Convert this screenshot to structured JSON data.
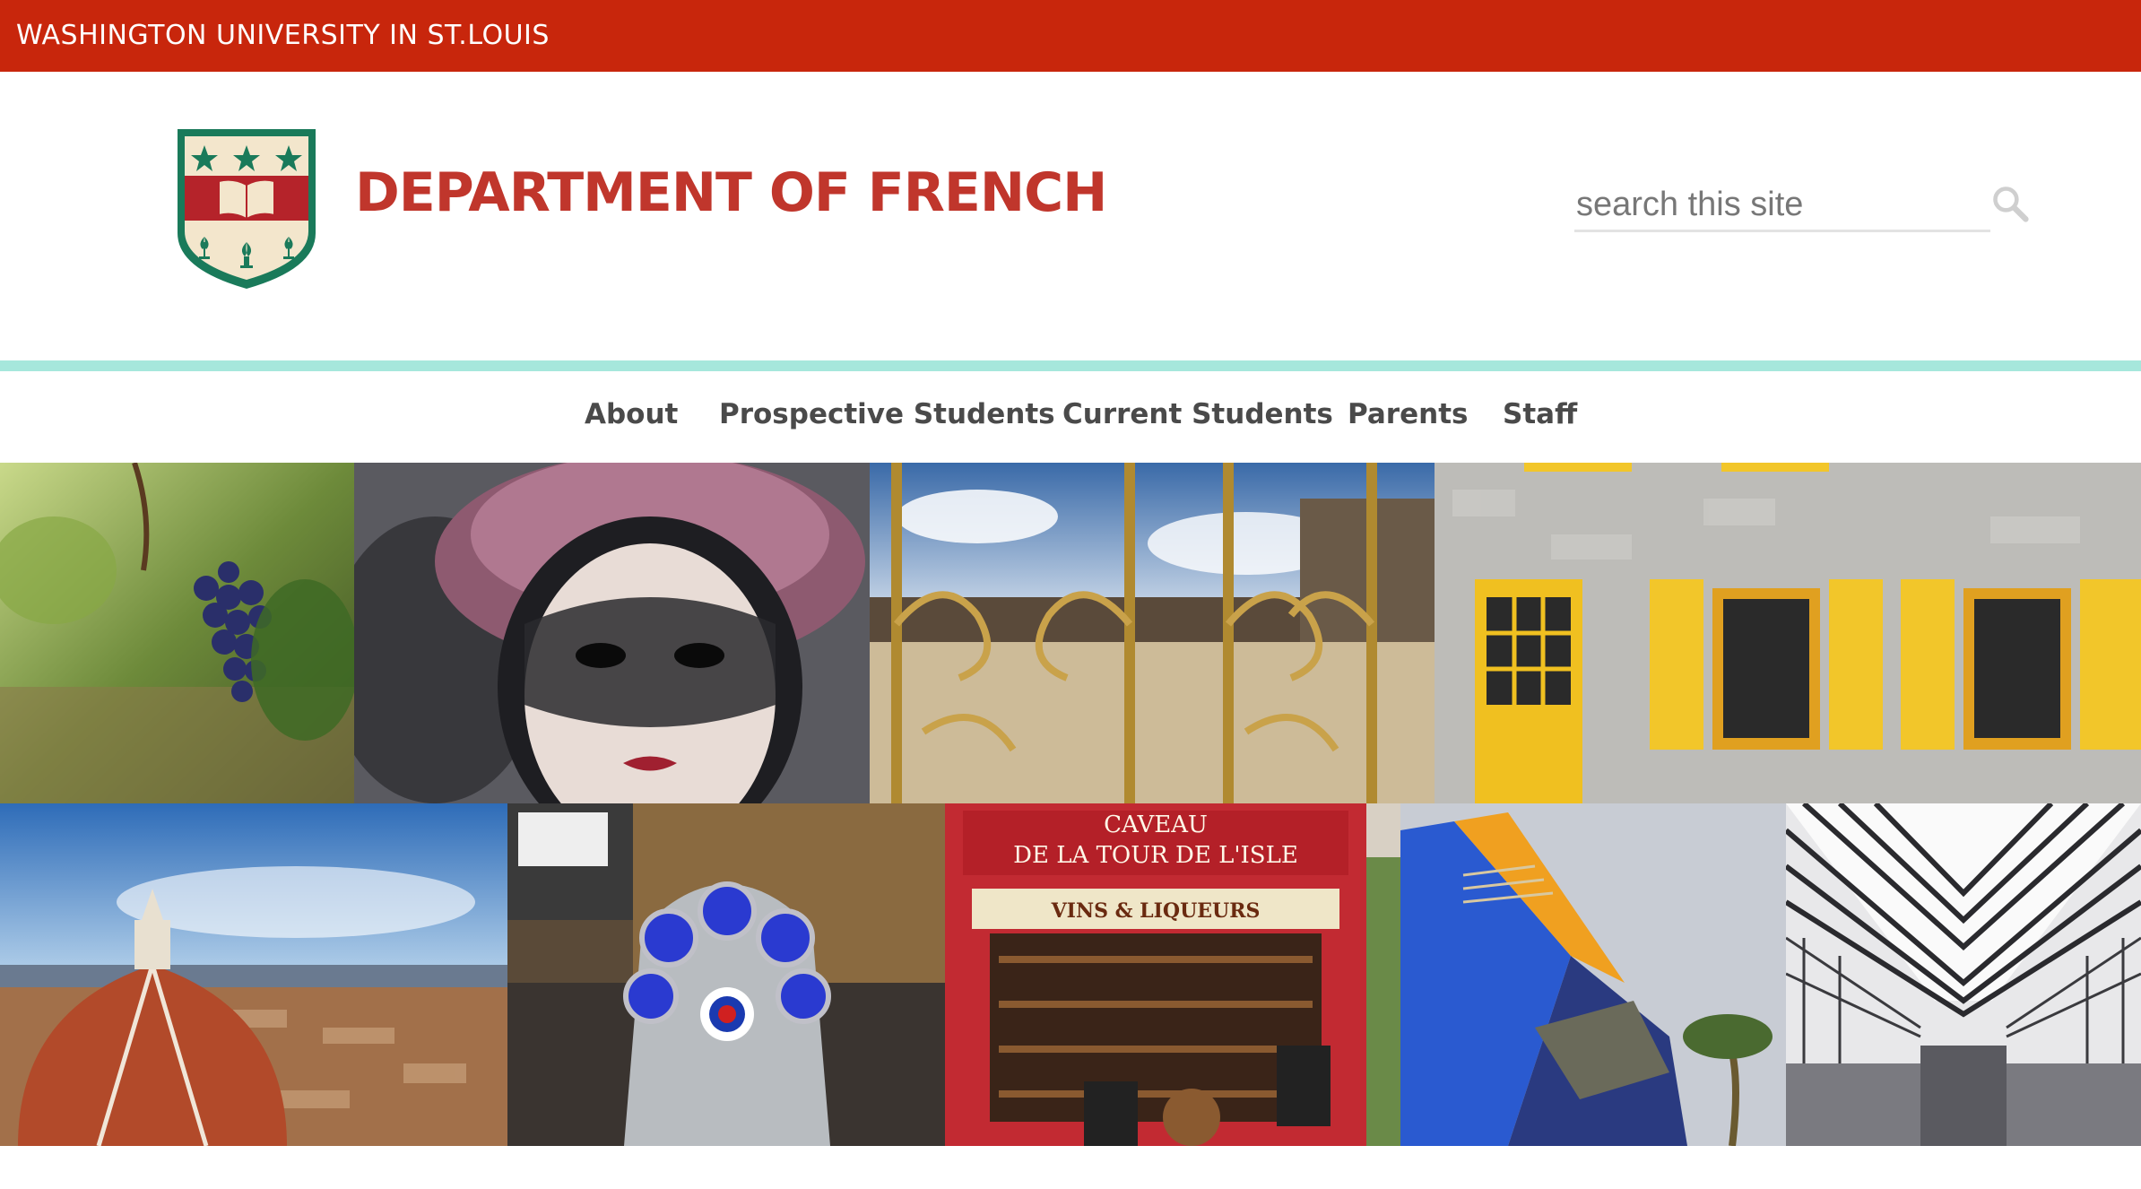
{
  "topbar": {
    "university": "WASHINGTON UNIVERSITY IN ST.LOUIS"
  },
  "header": {
    "department_title": "DEPARTMENT OF FRENCH",
    "logo_icon": "wustl-shield-icon"
  },
  "search": {
    "placeholder": "search this site",
    "value": "",
    "icon": "search-icon"
  },
  "nav": {
    "items": [
      {
        "label": "About"
      },
      {
        "label": "Prospective Students"
      },
      {
        "label": "Current Students"
      },
      {
        "label": "Parents"
      },
      {
        "label": "Staff"
      }
    ]
  },
  "colors": {
    "brand_red": "#c8260c",
    "title_red": "#c0362c",
    "accent_teal": "#a6e7dc",
    "nav_text": "#4a4a4a",
    "shield_green": "#1a7a5a"
  },
  "photos": [
    {
      "name": "grapes-vineyard-photo"
    },
    {
      "name": "venetian-mask-photo"
    },
    {
      "name": "golden-gate-versailles-photo"
    },
    {
      "name": "yellow-shutters-photo"
    },
    {
      "name": "florence-dome-photo"
    },
    {
      "name": "vespa-scooter-photo"
    },
    {
      "name": "caveau-storefront-photo",
      "sign_line1": "CAVEAU",
      "sign_line2": "DE LA TOUR DE L'ISLE",
      "awning": "VINS & LIQUEURS"
    },
    {
      "name": "modern-architecture-photo"
    },
    {
      "name": "lyon-station-photo"
    }
  ]
}
